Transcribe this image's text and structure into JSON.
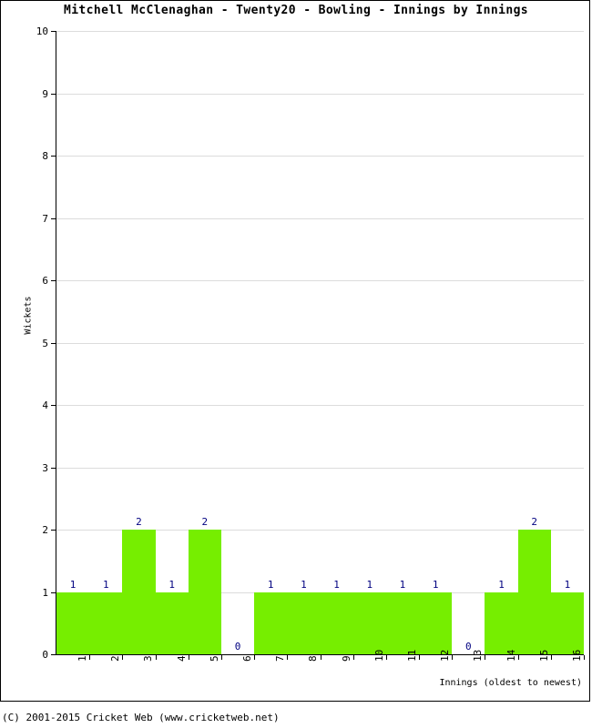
{
  "chart_data": {
    "type": "bar",
    "title": "Mitchell McClenaghan - Twenty20 - Bowling - Innings by Innings",
    "xlabel": "Innings (oldest to newest)",
    "ylabel": "Wickets",
    "categories": [
      "1",
      "2",
      "3",
      "4",
      "5",
      "6",
      "7",
      "8",
      "9",
      "10",
      "11",
      "12",
      "13",
      "14",
      "15",
      "16"
    ],
    "values": [
      1,
      1,
      2,
      1,
      2,
      0,
      1,
      1,
      1,
      1,
      1,
      1,
      0,
      1,
      2,
      1
    ],
    "data_labels": [
      "1",
      "1",
      "2",
      "1",
      "2",
      "0",
      "1",
      "1",
      "1",
      "1",
      "1",
      "1",
      "0",
      "1",
      "2",
      "1"
    ],
    "ylim": [
      0,
      10
    ],
    "yticks": [
      0,
      1,
      2,
      3,
      4,
      5,
      6,
      7,
      8,
      9,
      10
    ],
    "ytick_labels": [
      "0",
      "1",
      "2",
      "3",
      "4",
      "5",
      "6",
      "7",
      "8",
      "9",
      "10"
    ],
    "bar_color": "#76ee00",
    "label_color": "#000080",
    "grid": true,
    "grid_color": "#dcdcdc",
    "legend": null
  },
  "footer": {
    "copyright": "(C) 2001-2015 Cricket Web (www.cricketweb.net)"
  }
}
